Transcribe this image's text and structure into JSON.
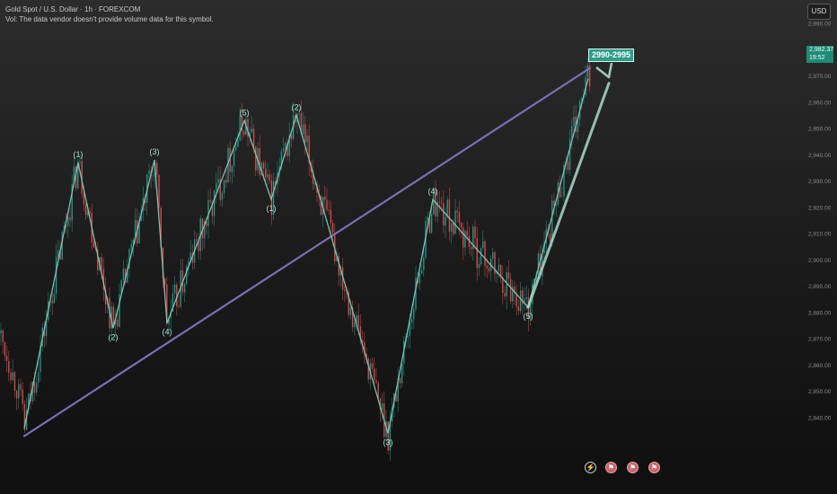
{
  "header": {
    "symbol_line": "Gold Spot / U.S. Dollar · 1h · FOREXCOM",
    "volume_line": "Vol: The data vendor doesn't provide volume data for this symbol."
  },
  "currency_button": "USD",
  "price_label": {
    "price": "2,982.37",
    "countdown": "19:52"
  },
  "target_label": "2990-2995",
  "bottom_icons": [
    {
      "name": "flash-icon",
      "glyph": "⚡"
    },
    {
      "name": "flag-icon",
      "glyph": "⚑"
    },
    {
      "name": "flag-icon",
      "glyph": "⚑"
    },
    {
      "name": "flag-icon",
      "glyph": "⚑"
    }
  ],
  "colors": {
    "up_candle": "#26a69a",
    "down_candle": "#ef5350",
    "wave_line": "#7fc9b5",
    "trend_line": "#7b6fb6",
    "target_box": "#2e9d88",
    "axis_text": "#8a8a8a"
  },
  "chart_data": {
    "type": "line",
    "title": "Gold Spot / U.S. Dollar · 1h · FOREXCOM",
    "ylabel": "USD",
    "y_axis_ticks": [
      2990,
      2980,
      2970,
      2960,
      2950,
      2940,
      2930,
      2920,
      2910,
      2900,
      2890,
      2880,
      2870,
      2860,
      2850,
      2840
    ],
    "y_axis_tick_labels": [
      "2,990.00",
      "2,980.00",
      "2,970.00",
      "2,960.00",
      "2,950.00",
      "2,940.00",
      "2,930.00",
      "2,920.00",
      "2,910.00",
      "2,900.00",
      "2,890.00",
      "2,880.00",
      "2,870.00",
      "2,860.00",
      "2,850.00",
      "2,840.00"
    ],
    "ylim": [
      2818,
      2998
    ],
    "grid": false,
    "candle_price_range": [
      2829,
      2983
    ],
    "last_price": 2982.37,
    "elliott_wave_path": [
      {
        "label": "",
        "price": 2836
      },
      {
        "label": "(1)",
        "price": 2937
      },
      {
        "label": "(2)",
        "price": 2874
      },
      {
        "label": "(3)",
        "price": 2938
      },
      {
        "label": "(4)",
        "price": 2876
      },
      {
        "label": "(5)",
        "price": 2953
      },
      {
        "label": "(1)",
        "price": 2923
      },
      {
        "label": "(2)",
        "price": 2955
      },
      {
        "label": "(3)",
        "price": 2834
      },
      {
        "label": "(4)",
        "price": 2923
      },
      {
        "label": "(5)",
        "price": 2882
      },
      {
        "label": "",
        "price": 2969
      }
    ],
    "trend_line": [
      {
        "price": 2833
      },
      {
        "price": 2973
      }
    ],
    "projection_target": {
      "label": "2990-2995",
      "price": 2972
    }
  }
}
